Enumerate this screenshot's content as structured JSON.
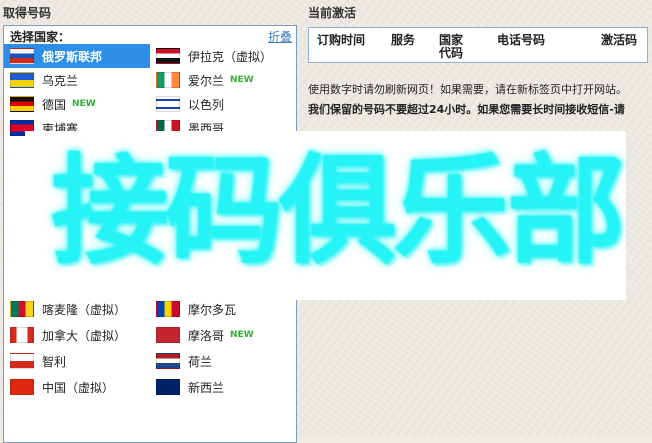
{
  "left_panel": {
    "title": "取得号码",
    "choose_label": "选择国家：",
    "collapse_label": "折叠",
    "countries": [
      {
        "name": "俄罗斯联邦",
        "flag": "russia",
        "selected": true,
        "new": ""
      },
      {
        "name": "伊拉克（虚拟）",
        "flag": "iraq",
        "selected": false,
        "new": ""
      },
      {
        "name": "乌克兰",
        "flag": "ukraine",
        "selected": false,
        "new": ""
      },
      {
        "name": "爱尔兰",
        "flag": "ireland",
        "selected": false,
        "new": "NEW"
      },
      {
        "name": "德国",
        "flag": "germany",
        "selected": false,
        "new": "NEW"
      },
      {
        "name": "以色列",
        "flag": "israel",
        "selected": false,
        "new": ""
      },
      {
        "name": "柬埔寨",
        "flag": "cambodia",
        "selected": false,
        "new": ""
      },
      {
        "name": "墨西哥",
        "flag": "mexico",
        "selected": false,
        "new": ""
      },
      {
        "name": "喀麦隆（虚拟）",
        "flag": "cameroon",
        "selected": false,
        "new": ""
      },
      {
        "name": "摩尔多瓦",
        "flag": "moldova",
        "selected": false,
        "new": ""
      },
      {
        "name": "加拿大（虚拟）",
        "flag": "canada",
        "selected": false,
        "new": ""
      },
      {
        "name": "摩洛哥",
        "flag": "morocco",
        "selected": false,
        "new": "NEW"
      },
      {
        "name": "智利",
        "flag": "chile",
        "selected": false,
        "new": ""
      },
      {
        "name": "荷兰",
        "flag": "netherlands",
        "selected": false,
        "new": ""
      },
      {
        "name": "中国（虚拟）",
        "flag": "china",
        "selected": false,
        "new": ""
      },
      {
        "name": "新西兰",
        "flag": "newzealand",
        "selected": false,
        "new": ""
      }
    ]
  },
  "right_panel": {
    "title": "当前激活",
    "columns": [
      "订购时间",
      "服务",
      "国家\n代码",
      "电话号码",
      "激活码"
    ],
    "message_1": "使用数字时请勿刷新网页！如果需要，请在新标签页中打开网站。",
    "message_2": "我们保留的号码不要超过24小时。如果您需要长时间接收短信-请"
  },
  "watermark": {
    "text": "接码俱乐部",
    "color": "#26f3f6"
  },
  "colors": {
    "selected_row": "#2d8ee8",
    "new_badge": "#2db32d",
    "link": "#3a7fc0",
    "panel_border": "#7a9cc4"
  }
}
